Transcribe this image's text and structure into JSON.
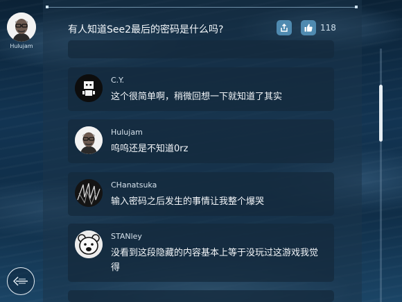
{
  "header": {
    "user_name": "Hulujam",
    "title": "有人知道See2最后的密码是什么吗?",
    "like_count": "118",
    "icons": {
      "share": "share-icon",
      "like": "thumbs-up-icon",
      "back": "back-arrow-icon"
    }
  },
  "comments": [
    {
      "name": "C.Y.",
      "text": "这个很简单啊，稍微回想一下就知道了其实",
      "avatar": "robot-avatar"
    },
    {
      "name": "Hulujam",
      "text": "呜呜还是不知道0rz",
      "avatar": "man-glasses-avatar"
    },
    {
      "name": "CHanatsuka",
      "text": "输入密码之后发生的事情让我整个爆哭",
      "avatar": "sketch-face-avatar"
    },
    {
      "name": "STANley",
      "text": "没看到这段隐藏的内容基本上等于没玩过这游戏我觉得",
      "avatar": "bear-avatar"
    }
  ],
  "colors": {
    "accent": "#4f8ab0",
    "card_bg": "#142a3e",
    "text": "#f3f6f9"
  }
}
